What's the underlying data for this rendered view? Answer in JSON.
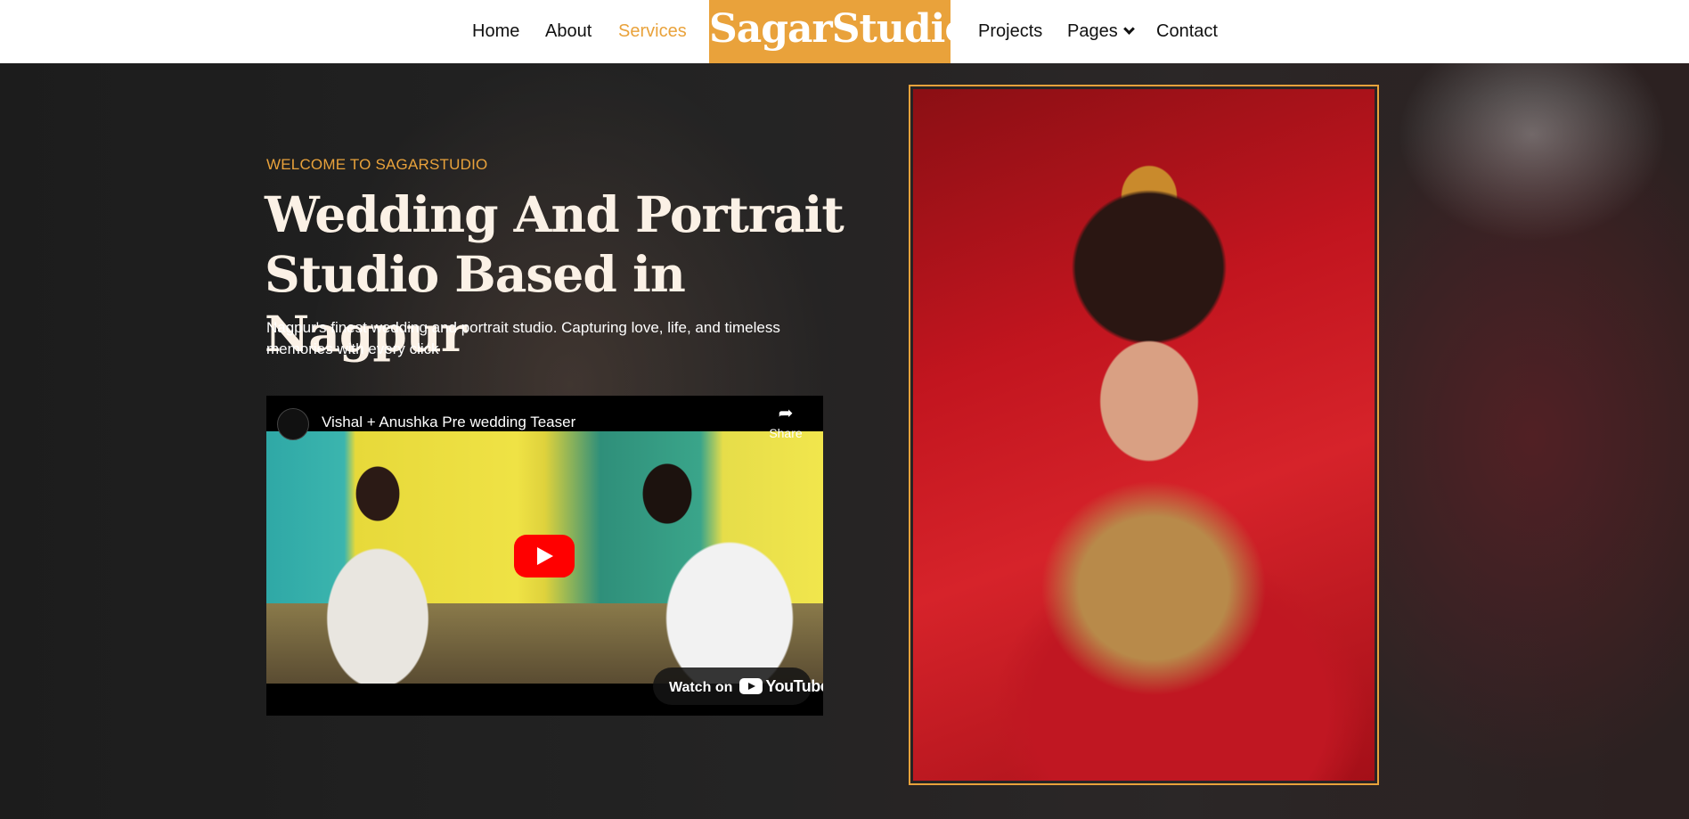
{
  "nav": {
    "left_items": [
      {
        "label": "Home"
      },
      {
        "label": "About"
      },
      {
        "label": "Services",
        "active": true
      }
    ],
    "brand": "SagarStudio",
    "right_items": [
      {
        "label": "Projects"
      },
      {
        "label": "Pages"
      },
      {
        "label": "Contact"
      }
    ]
  },
  "hero": {
    "eyebrow": "WELCOME TO SAGARSTUDIO",
    "heading_line1": "Wedding And Portrait",
    "heading_line2": "Studio Based in Nagpur",
    "subtext": "Nagpur's finest wedding and portrait studio. Capturing love, life, and timeless memories with every click"
  },
  "video": {
    "title": "Vishal + Anushka Pre wedding Teaser",
    "share_label": "Share",
    "watch_on_label": "Watch on",
    "youtube_word": "YouTube"
  },
  "colors": {
    "accent": "#e9a23b",
    "nav_bg": "#ffffff",
    "heading_text": "#fbf1e6",
    "play_button": "#ff0000"
  },
  "icons": {
    "share": "share-arrow-icon",
    "play": "play-icon",
    "dropdown": "chevron-down-icon",
    "youtube": "youtube-logo-icon"
  }
}
